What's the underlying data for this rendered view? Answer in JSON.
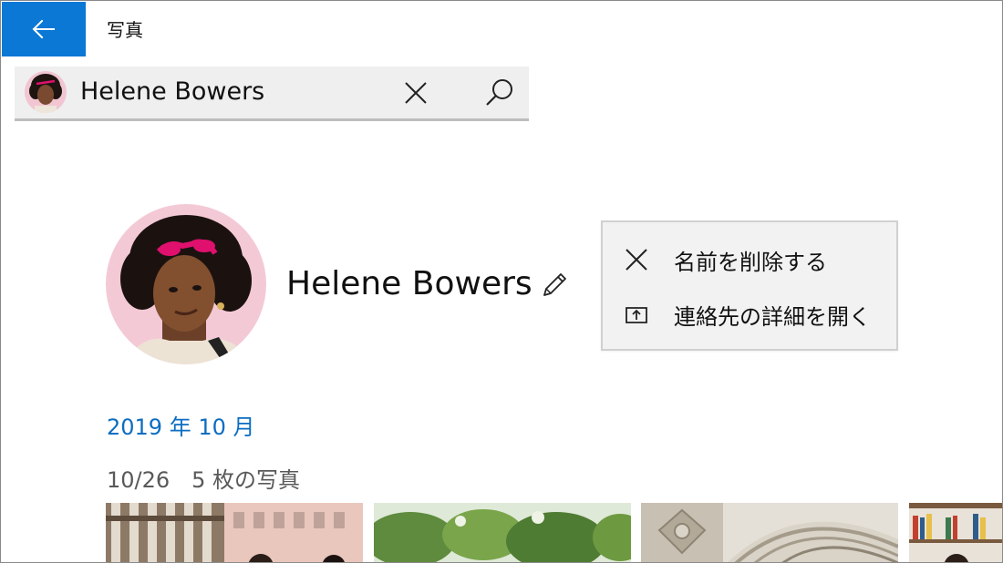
{
  "titlebar": {
    "back_icon": "arrow-left-icon",
    "app_title": "写真"
  },
  "search": {
    "value": "Helene Bowers",
    "clear_icon": "close-icon",
    "search_icon": "search-icon"
  },
  "person": {
    "name": "Helene Bowers",
    "edit_icon": "pencil-icon"
  },
  "context_menu": {
    "items": [
      {
        "label": "名前を削除する",
        "icon": "close-icon"
      },
      {
        "label": "連絡先の詳細を開く",
        "icon": "open-contact-icon"
      }
    ]
  },
  "timeline": {
    "month": "2019 年 10 月",
    "day": "10/26　5 枚の写真"
  },
  "colors": {
    "accent": "#0a78d4",
    "link": "#0b6dc2",
    "menu_bg": "#f2f2f2",
    "search_bg": "#efefef"
  }
}
